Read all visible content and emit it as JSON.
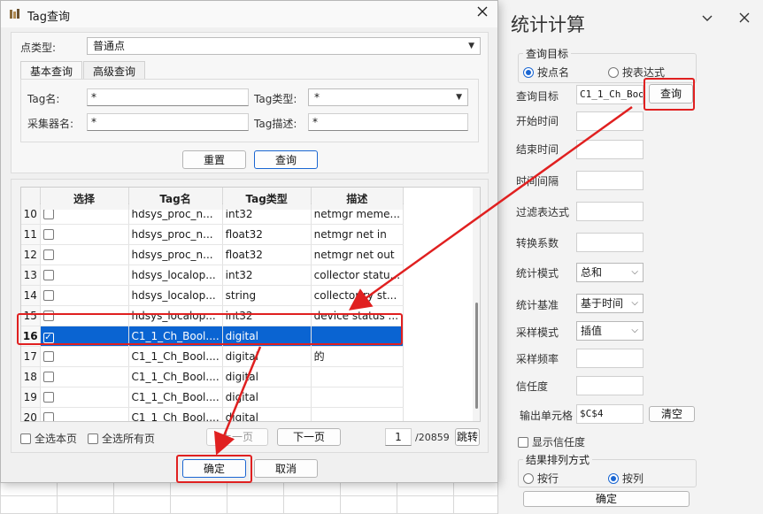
{
  "dialog": {
    "title": "Tag查询",
    "point_type_label": "点类型:",
    "point_type_value": "普通点",
    "tabs": [
      "基本查询",
      "高级查询"
    ],
    "tag_name_label": "Tag名:",
    "tag_name_value": "*",
    "tag_type_label": "Tag类型:",
    "tag_type_value": "*",
    "collector_label": "采集器名:",
    "collector_value": "*",
    "tag_desc_label": "Tag描述:",
    "tag_desc_value": "*",
    "reset_label": "重置",
    "query_label": "查询",
    "table": {
      "headers": [
        "选择",
        "Tag名",
        "Tag类型",
        "描述"
      ],
      "rows": [
        {
          "num": "10",
          "name": "hdsys_proc_n...",
          "type": "int32",
          "desc": "netmgr meme..."
        },
        {
          "num": "11",
          "name": "hdsys_proc_n...",
          "type": "float32",
          "desc": "netmgr net in"
        },
        {
          "num": "12",
          "name": "hdsys_proc_n...",
          "type": "float32",
          "desc": "netmgr net out"
        },
        {
          "num": "13",
          "name": "hdsys_localop...",
          "type": "int32",
          "desc": "collector statu..."
        },
        {
          "num": "14",
          "name": "hdsys_localop...",
          "type": "string",
          "desc": "collector ry st..."
        },
        {
          "num": "15",
          "name": "hdsys_localop...",
          "type": "int32",
          "desc": "device status ..."
        },
        {
          "num": "16",
          "name": "C1_1_Ch_Bool....",
          "type": "digital",
          "desc": ""
        },
        {
          "num": "17",
          "name": "C1_1_Ch_Bool....",
          "type": "digital",
          "desc": "的"
        },
        {
          "num": "18",
          "name": "C1_1_Ch_Bool....",
          "type": "digital",
          "desc": ""
        },
        {
          "num": "19",
          "name": "C1_1_Ch_Bool....",
          "type": "digital",
          "desc": ""
        },
        {
          "num": "20",
          "name": "C1_1_Ch_Bool....",
          "type": "digital",
          "desc": ""
        }
      ]
    },
    "select_page_label": "全选本页",
    "select_all_label": "全选所有页",
    "prev_label": "上一页",
    "next_label": "下一页",
    "page_value": "1",
    "page_total": "/20859",
    "jump_label": "跳转",
    "ok_label": "确定",
    "cancel_label": "取消"
  },
  "pane": {
    "title": "统计计算",
    "group_query_target": "查询目标",
    "radio_by_name": "按点名",
    "radio_by_expr": "按表达式",
    "query_target_label": "查询目标",
    "query_target_value": "C1_1_Ch_Bool",
    "query_button": "查询",
    "start_time_label": "开始时间",
    "end_time_label": "结束时间",
    "interval_label": "时间间隔",
    "filter_label": "过滤表达式",
    "factor_label": "转换系数",
    "stat_mode_label": "统计模式",
    "stat_mode_value": "总和",
    "stat_base_label": "统计基准",
    "stat_base_value": "基于时间",
    "sample_mode_label": "采样模式",
    "sample_mode_value": "插值",
    "sample_rate_label": "采样频率",
    "confidence_label": "信任度",
    "output_cell_label": "输出单元格",
    "output_cell_value": "$C$4",
    "clear_button": "清空",
    "show_confidence_label": "显示信任度",
    "result_order_group": "结果排列方式",
    "by_row_label": "按行",
    "by_col_label": "按列",
    "ok_button": "确定"
  },
  "colors": {
    "accent": "#0a64d2",
    "highlight": "#e02020"
  }
}
